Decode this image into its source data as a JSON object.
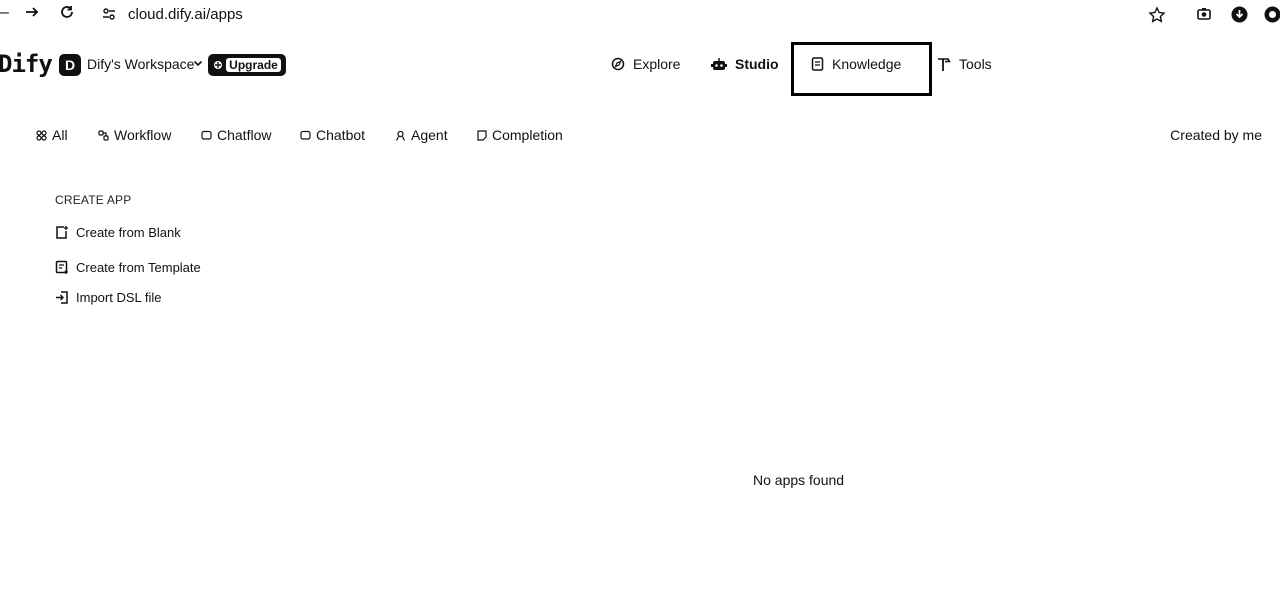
{
  "browser": {
    "url": "cloud.dify.ai/apps"
  },
  "header": {
    "logo": "Dify",
    "workspace_initial": "D",
    "workspace_name": "Dify's Workspace",
    "upgrade_label": "Upgrade",
    "nav": {
      "explore": "Explore",
      "studio": "Studio",
      "knowledge": "Knowledge",
      "tools": "Tools"
    }
  },
  "filters": {
    "tabs": [
      "All",
      "Workflow",
      "Chatflow",
      "Chatbot",
      "Agent",
      "Completion"
    ],
    "created_by": "Created by me"
  },
  "create_app": {
    "title": "CREATE APP",
    "items": [
      "Create from Blank",
      "Create from Template",
      "Import DSL file"
    ]
  },
  "empty_state": {
    "message": "No apps found"
  }
}
